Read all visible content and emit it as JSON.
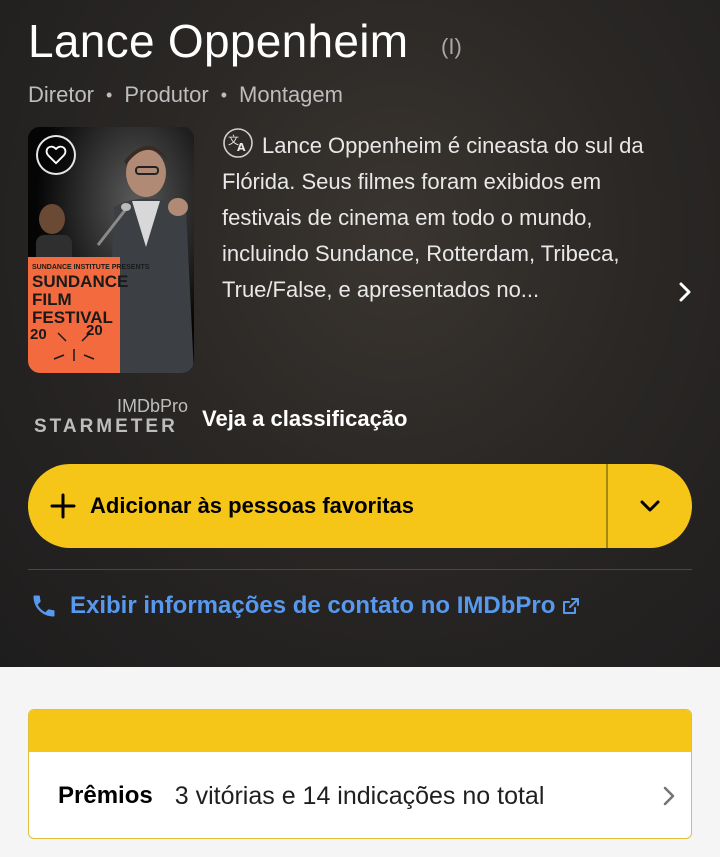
{
  "person": {
    "name": "Lance Oppenheim",
    "name_suffix": "(I)",
    "roles": [
      "Diretor",
      "Produtor",
      "Montagem"
    ],
    "bio": "Lance Oppenheim é cineasta do sul da Flórida. Seus filmes foram exibidos em festivais de cinema em todo o mundo, incluindo Sundance, Rotterdam, Tribeca, True/False, e apresentados no..."
  },
  "poster": {
    "banner_lines": [
      "SUNDANCE INSTITUTE PRESENTS",
      "SUNDANCE",
      "FILM",
      "FESTIVAL",
      "20",
      "20"
    ]
  },
  "starmeter": {
    "brand": "IMDbPro",
    "label": "STARMETER",
    "link_text": "Veja a classificação"
  },
  "favorite_button": {
    "label": "Adicionar às pessoas favoritas"
  },
  "contact": {
    "label": "Exibir informações de contato no IMDbPro"
  },
  "awards": {
    "title": "Prêmios",
    "summary": "3 vitórias e 14 indicações no total"
  },
  "colors": {
    "accent_yellow": "#f5c518",
    "link_blue": "#5799ef",
    "hero_background": "#1f1f1f"
  },
  "icons": {
    "favorite": "heart-icon",
    "translate": "translate-icon",
    "more": "chevron-right-icon",
    "add": "plus-icon",
    "dropdown": "chevron-down-icon",
    "phone": "phone-icon",
    "external": "external-link-icon"
  }
}
